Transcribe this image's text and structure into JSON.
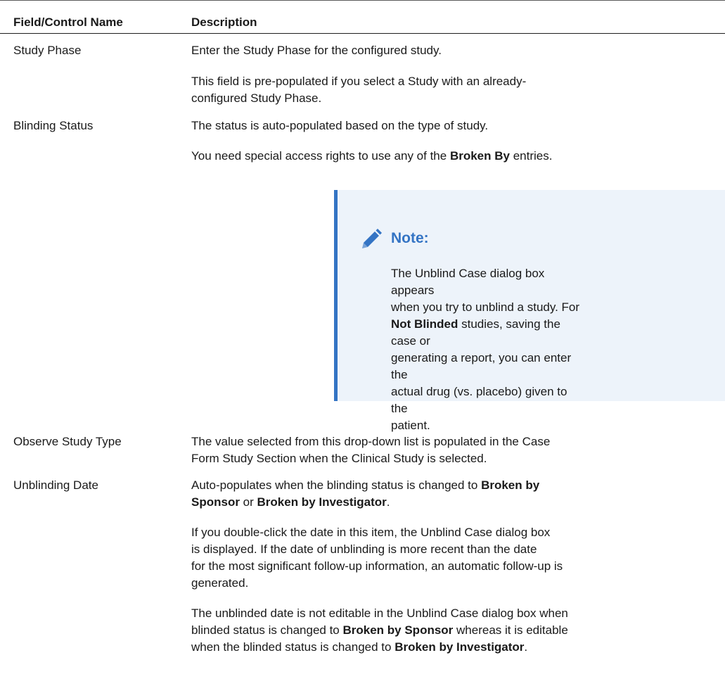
{
  "table": {
    "headers": [
      "Field/Control Name",
      "Description"
    ],
    "rows": [
      {
        "name": "Study Phase",
        "desc": [
          "Enter the Study Phase for the configured study.",
          "This field is pre-populated if you select a Study with an already-",
          "configured Study Phase."
        ]
      },
      {
        "name": "Blinding Status",
        "desc1": "The status is auto-populated based on the type of study.",
        "desc2_pre": "You need special access rights to use any of the ",
        "desc2_bold": "Broken By",
        "desc2_post": " entries."
      },
      {
        "name": "Observe Study Type",
        "desc": [
          "The value selected from this drop-down list is populated in the Case",
          "Form Study Section when the Clinical Study is selected."
        ]
      },
      {
        "name": "Unblinding Date",
        "p1_pre": "Auto-populates when the blinding status is changed to ",
        "p1_bold1": "Broken by",
        "p1_bold1b": "Sponsor",
        "p1_mid": " or ",
        "p1_bold2": "Broken by Investigator",
        "p1_post": ".",
        "p2": [
          "If you double-click the date in this item, the Unblind Case dialog box",
          "is displayed. If the date of unblinding is more recent than the date",
          "for the most significant follow-up information, an automatic follow-up is",
          "generated."
        ],
        "p3_line1": "The unblinded date is not editable in the Unblind Case dialog box when",
        "p3_pre": "blinded status is changed to ",
        "p3_bold1": "Broken by Sponsor",
        "p3_mid": " whereas it is editable",
        "p3_line3_pre": "when the blinded status is changed to ",
        "p3_bold2": "Broken by Investigator",
        "p3_post": "."
      }
    ]
  },
  "note": {
    "title": "Note:",
    "icon": "pencil-icon",
    "accent_color": "#3474c4",
    "background_color": "#edf3fa",
    "line1": "The Unblind Case dialog box appears",
    "line2": "when you try to unblind a study. For",
    "bold": "Not Blinded",
    "line3_post": " studies, saving the case or",
    "line4": "generating a report, you can enter the",
    "line5": "actual drug (vs. placebo) given to the",
    "line6": "patient."
  }
}
